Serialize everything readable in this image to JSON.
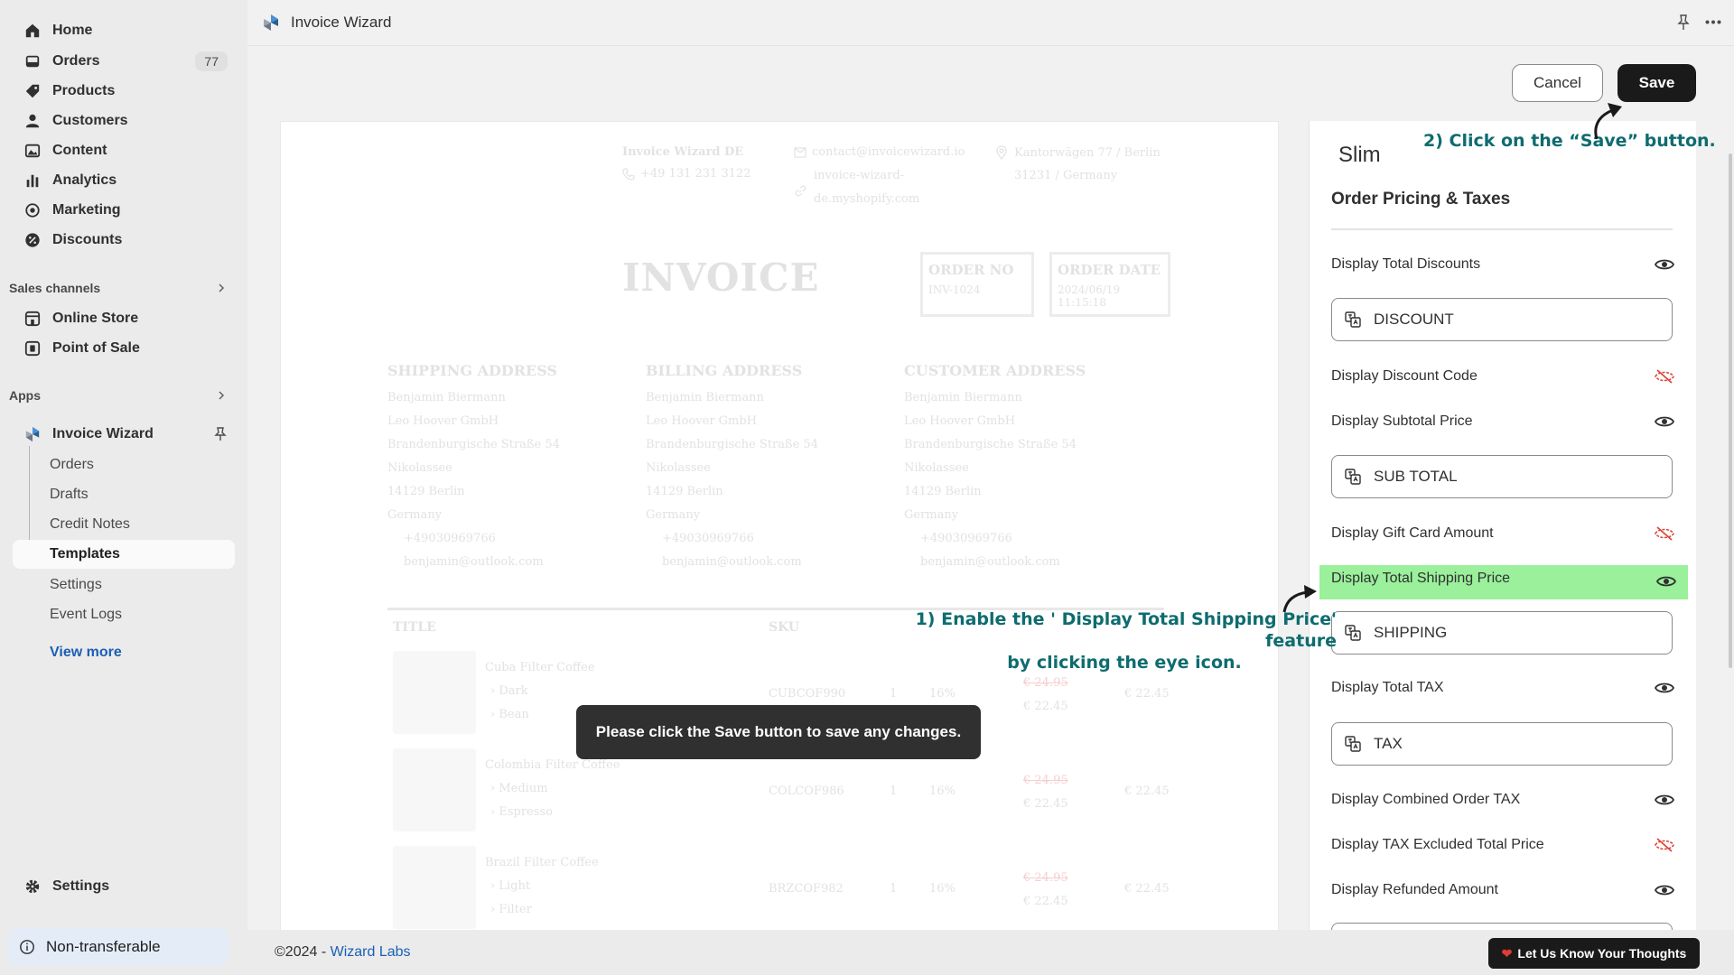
{
  "sidebar": {
    "items": [
      {
        "label": "Home",
        "icon": "home-icon"
      },
      {
        "label": "Orders",
        "icon": "inbox-icon",
        "badge": "77"
      },
      {
        "label": "Products",
        "icon": "tag-icon"
      },
      {
        "label": "Customers",
        "icon": "person-icon"
      },
      {
        "label": "Content",
        "icon": "image-icon"
      },
      {
        "label": "Analytics",
        "icon": "bar-chart-icon"
      },
      {
        "label": "Marketing",
        "icon": "target-icon"
      },
      {
        "label": "Discounts",
        "icon": "percent-icon"
      }
    ],
    "sales_channels": {
      "title": "Sales channels",
      "items": [
        {
          "label": "Online Store",
          "icon": "store-icon"
        },
        {
          "label": "Point of Sale",
          "icon": "pos-icon"
        }
      ]
    },
    "apps": {
      "title": "Apps",
      "app_name": "Invoice Wizard",
      "sub_items": [
        "Orders",
        "Drafts",
        "Credit Notes",
        "Templates",
        "Settings",
        "Event Logs"
      ],
      "active_sub": "Templates",
      "view_more": "View more"
    },
    "settings_label": "Settings",
    "non_transferable": "Non-transferable"
  },
  "topbar": {
    "title": "Invoice Wizard"
  },
  "actions": {
    "cancel": "Cancel",
    "save": "Save"
  },
  "invoice": {
    "company": "Invoice Wizard DE",
    "phone": "+49 131 231 3122",
    "email": "contact@invoicewizard.io",
    "site_line1": "invoice-wizard-",
    "site_line2": "de.myshopify.com",
    "address_line1": "Kantorwägen 77 / Berlin",
    "address_line2": "31231 / Germany",
    "title": "INVOICE",
    "order_no_label": "ORDER NO",
    "order_no_value": "INV-1024",
    "order_date_label": "ORDER DATE",
    "order_date_value": "2024/06/19 11:15:18",
    "addresses": [
      {
        "heading": "SHIPPING ADDRESS"
      },
      {
        "heading": "BILLING ADDRESS"
      },
      {
        "heading": "CUSTOMER ADDRESS"
      }
    ],
    "addr_lines": [
      "Benjamin Biermann",
      "Leo Hoover GmbH",
      "Brandenburgische Straße 54",
      "Nikolassee",
      "14129 Berlin",
      "Germany"
    ],
    "addr_phone": "+49030969766",
    "addr_email": "benjamin@outlook.com",
    "table_title": "TITLE",
    "table_sku": "SKU",
    "rows": [
      {
        "name": "Cuba Filter Coffee",
        "v1": "Dark",
        "v2": "Bean",
        "sku": "CUBCOF990",
        "qty": "1",
        "tax": "16%",
        "old": "€ 24.95",
        "price": "€ 22.45",
        "total": "€ 22.45"
      },
      {
        "name": "Colombia Filter Coffee",
        "v1": "Medium",
        "v2": "Espresso",
        "sku": "COLCOF986",
        "qty": "1",
        "tax": "16%",
        "old": "€ 24.95",
        "price": "€ 22.45",
        "total": "€ 22.45"
      },
      {
        "name": "Brazil Filter Coffee",
        "v1": "Light",
        "v2": "Filter",
        "sku": "BRZCOF982",
        "qty": "1",
        "tax": "16%",
        "old": "€ 24.95",
        "price": "€ 22.45",
        "total": "€ 22.45"
      }
    ]
  },
  "toast": "Please click the Save button to save any changes.",
  "panel": {
    "theme": "Slim",
    "section": "Order Pricing & Taxes",
    "rows": [
      {
        "label": "Display Total Discounts",
        "visible": true
      },
      {
        "input": "DISCOUNT"
      },
      {
        "label": "Display Discount Code",
        "visible": false
      },
      {
        "label": "Display Subtotal Price",
        "visible": true
      },
      {
        "input": "SUB TOTAL"
      },
      {
        "label": "Display Gift Card Amount",
        "visible": false
      },
      {
        "label": "Display Total Shipping Price",
        "visible": true,
        "highlight": true
      },
      {
        "input": "SHIPPING"
      },
      {
        "label": "Display Total TAX",
        "visible": true
      },
      {
        "input": "TAX"
      },
      {
        "label": "Display Combined Order TAX",
        "visible": true
      },
      {
        "label": "Display TAX Excluded Total Price",
        "visible": false
      },
      {
        "label": "Display Refunded Amount",
        "visible": true
      }
    ]
  },
  "annotations": {
    "step1_line1": "1) Enable the ' Display Total Shipping Price' feature",
    "step1_line2": "by clicking the eye icon.",
    "step2": "2) Click on the “Save” button."
  },
  "footer": {
    "copyright": "©2024 - ",
    "brand": "Wizard Labs",
    "feedback": "Let Us Know Your Thoughts"
  },
  "colors": {
    "accent_link": "#1a5fb4",
    "highlight": "#9af09b",
    "annotation": "#0e6c6f",
    "hidden_eye": "#e0453a"
  }
}
